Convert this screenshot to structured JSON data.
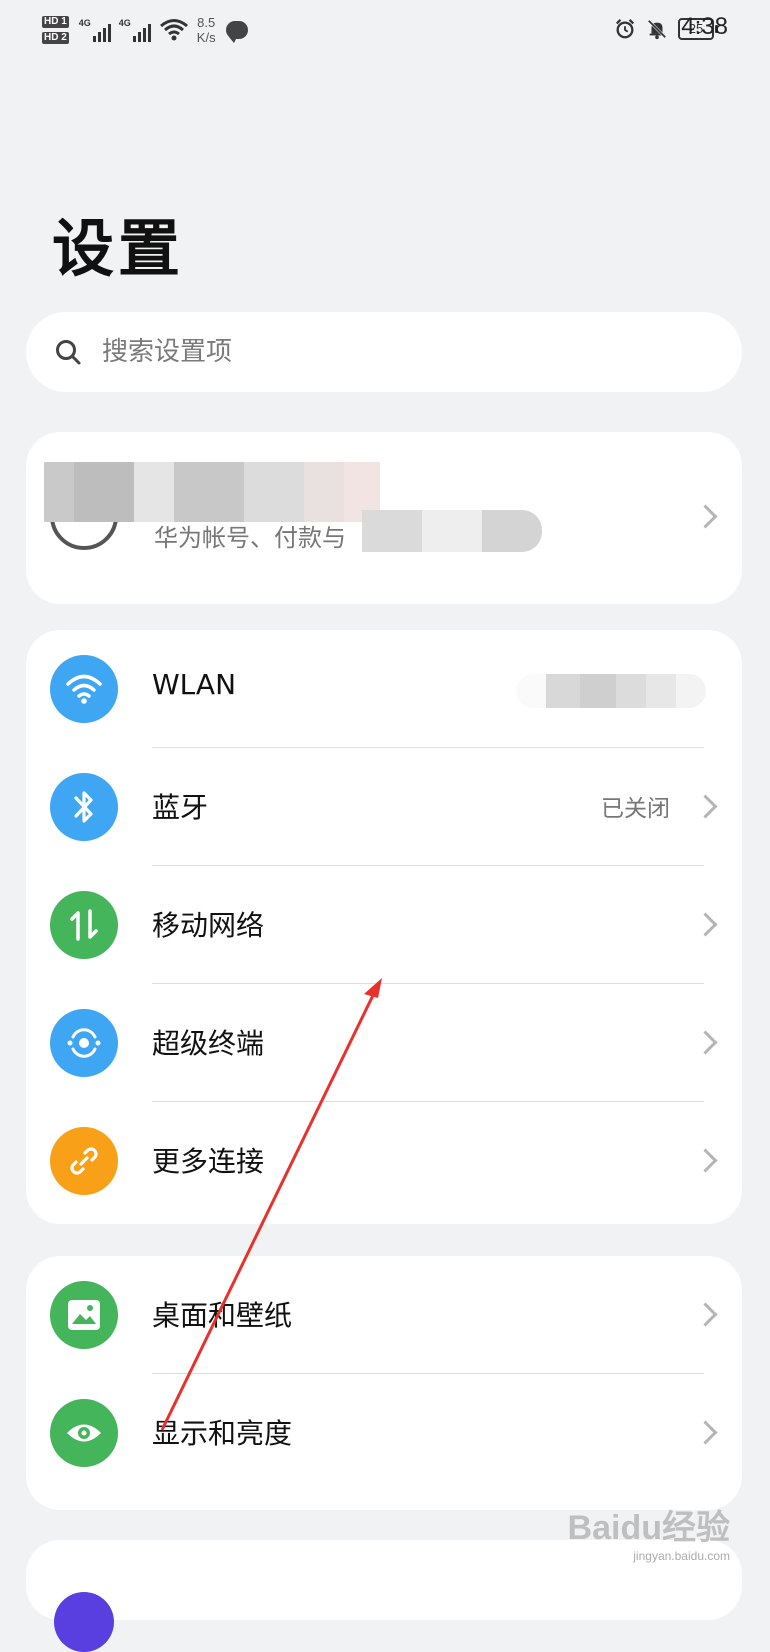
{
  "status_bar": {
    "sim1": "HD 1",
    "sim2": "HD 2",
    "net1": "4G",
    "net2": "4G",
    "speed_value": "8.5",
    "speed_unit": "K/s",
    "battery": "25",
    "time": "4:38",
    "icons": [
      "signal-icon",
      "wifi-icon",
      "message-icon",
      "alarm-icon",
      "mute-icon",
      "battery-icon"
    ]
  },
  "page": {
    "title": "设置"
  },
  "search": {
    "placeholder": "搜索设置项"
  },
  "account": {
    "subtitle": "华为帐号、付款与"
  },
  "groups": [
    {
      "items": [
        {
          "label": "WLAN",
          "value": "",
          "icon": "wifi-icon",
          "color": "#3ea6f2"
        },
        {
          "label": "蓝牙",
          "value": "已关闭",
          "icon": "bluetooth-icon",
          "color": "#3ea6f2"
        },
        {
          "label": "移动网络",
          "value": "",
          "icon": "mobile-data-icon",
          "color": "#44b55a"
        },
        {
          "label": "超级终端",
          "value": "",
          "icon": "super-device-icon",
          "color": "#3ea6f2"
        },
        {
          "label": "更多连接",
          "value": "",
          "icon": "link-icon",
          "color": "#f8a017"
        }
      ]
    },
    {
      "items": [
        {
          "label": "桌面和壁纸",
          "value": "",
          "icon": "wallpaper-icon",
          "color": "#44b55a"
        },
        {
          "label": "显示和亮度",
          "value": "",
          "icon": "eye-icon",
          "color": "#44b55a"
        }
      ]
    }
  ],
  "watermark": {
    "main": "Baidu经验",
    "sub": "jingyan.baidu.com"
  }
}
